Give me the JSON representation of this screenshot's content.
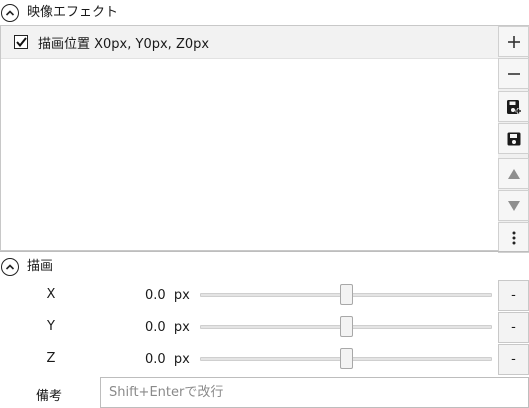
{
  "effects_section": {
    "title": "映像エフェクト",
    "toggle_icon": "chevron-up-icon",
    "items": [
      {
        "label": "描画位置 X0px, Y0px, Z0px",
        "checked": true
      }
    ],
    "toolbar": {
      "add": {
        "icon": "plus-icon",
        "glyph": "+"
      },
      "remove": {
        "icon": "minus-icon",
        "glyph": "−"
      },
      "save_preset": {
        "icon": "save-plus-icon"
      },
      "save": {
        "icon": "save-icon"
      },
      "move_up": {
        "icon": "triangle-up-icon",
        "glyph": "▲"
      },
      "move_down": {
        "icon": "triangle-down-icon",
        "glyph": "▼"
      },
      "more": {
        "icon": "more-vertical-icon",
        "glyph": "⋮"
      }
    }
  },
  "draw_section": {
    "title": "描画",
    "toggle_icon": "chevron-up-icon",
    "properties": [
      {
        "label": "X",
        "value": "0.0",
        "unit": "px",
        "slider_fraction": 0.5,
        "button": "-"
      },
      {
        "label": "Y",
        "value": "0.0",
        "unit": "px",
        "slider_fraction": 0.5,
        "button": "-"
      },
      {
        "label": "Z",
        "value": "0.0",
        "unit": "px",
        "slider_fraction": 0.5,
        "button": "-"
      }
    ],
    "note": {
      "label": "備考",
      "placeholder": "Shift+Enterで改行",
      "value": ""
    }
  },
  "colors": {
    "border": "#c8c8c8",
    "toolbar_bg": "#f0f0f0",
    "selected_row_bg": "#f2f2f2",
    "disabled_icon": "#8f8f8f"
  }
}
